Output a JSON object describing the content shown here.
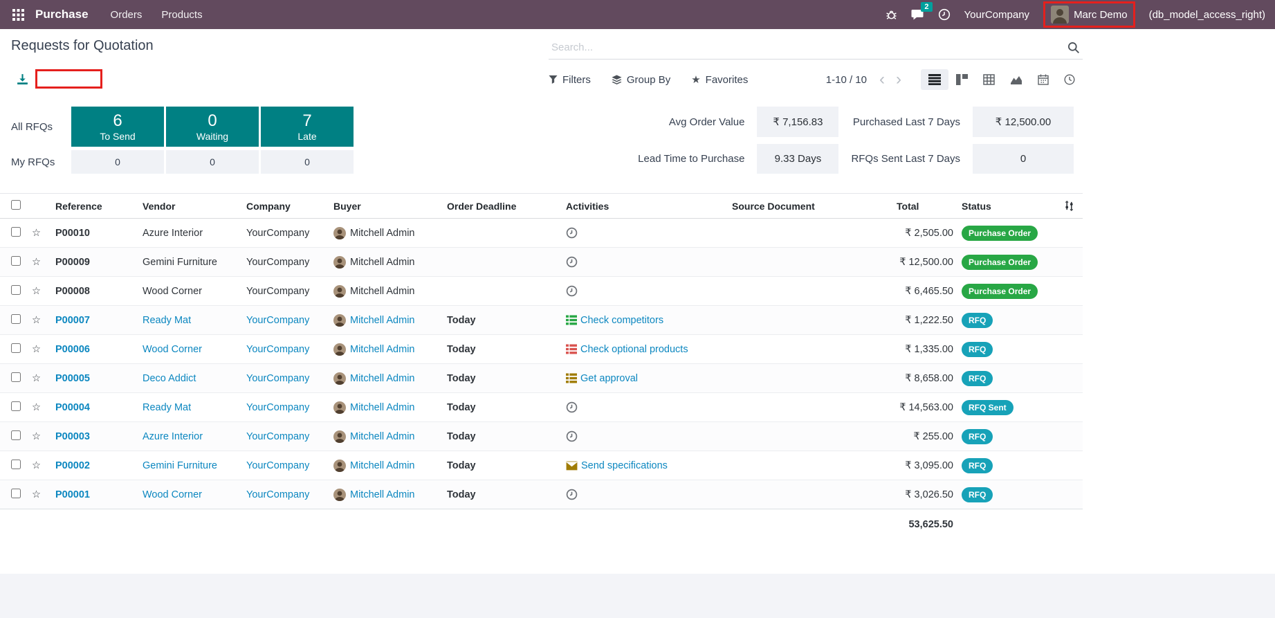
{
  "topbar": {
    "app_name": "Purchase",
    "menus": [
      {
        "label": "Orders"
      },
      {
        "label": "Products"
      }
    ],
    "message_count": "2",
    "company": "YourCompany",
    "user_name": "Marc Demo",
    "user_suffix": "(db_model_access_right)"
  },
  "page": {
    "title": "Requests for Quotation"
  },
  "search": {
    "placeholder": "Search..."
  },
  "controls": {
    "filters_label": "Filters",
    "group_by_label": "Group By",
    "favorites_label": "Favorites",
    "pager": "1-10 / 10"
  },
  "dashboard": {
    "all_label": "All RFQs",
    "my_label": "My RFQs",
    "boxes": [
      {
        "value": "6",
        "label": "To Send",
        "my_value": "0"
      },
      {
        "value": "0",
        "label": "Waiting",
        "my_value": "0"
      },
      {
        "value": "7",
        "label": "Late",
        "my_value": "0"
      }
    ],
    "stats": [
      {
        "label": "Avg Order Value",
        "value": "₹ 7,156.83"
      },
      {
        "label": "Purchased Last 7 Days",
        "value": "₹ 12,500.00"
      },
      {
        "label": "Lead Time to Purchase",
        "value": "9.33 Days"
      },
      {
        "label": "RFQs Sent Last 7 Days",
        "value": "0"
      }
    ]
  },
  "table": {
    "columns": [
      "Reference",
      "Vendor",
      "Company",
      "Buyer",
      "Order Deadline",
      "Activities",
      "Source Document",
      "Total",
      "Status"
    ],
    "rows": [
      {
        "ref": "P00010",
        "vendor": "Azure Interior",
        "company": "YourCompany",
        "buyer": "Mitchell Admin",
        "deadline": "",
        "activity": {
          "icon": "clock",
          "color": "act-gray",
          "label": ""
        },
        "total": "₹ 2,505.00",
        "status": "Purchase Order",
        "status_class": "green",
        "row_class": "plain"
      },
      {
        "ref": "P00009",
        "vendor": "Gemini Furniture",
        "company": "YourCompany",
        "buyer": "Mitchell Admin",
        "deadline": "",
        "activity": {
          "icon": "clock",
          "color": "act-gray",
          "label": ""
        },
        "total": "₹ 12,500.00",
        "status": "Purchase Order",
        "status_class": "green",
        "row_class": "plain"
      },
      {
        "ref": "P00008",
        "vendor": "Wood Corner",
        "company": "YourCompany",
        "buyer": "Mitchell Admin",
        "deadline": "",
        "activity": {
          "icon": "clock",
          "color": "act-gray",
          "label": ""
        },
        "total": "₹ 6,465.50",
        "status": "Purchase Order",
        "status_class": "green",
        "row_class": "plain"
      },
      {
        "ref": "P00007",
        "vendor": "Ready Mat",
        "company": "YourCompany",
        "buyer": "Mitchell Admin",
        "deadline": "Today",
        "activity": {
          "icon": "list",
          "color": "act-green",
          "label": "Check competitors"
        },
        "total": "₹ 1,222.50",
        "status": "RFQ",
        "status_class": "teal",
        "row_class": "linked"
      },
      {
        "ref": "P00006",
        "vendor": "Wood Corner",
        "company": "YourCompany",
        "buyer": "Mitchell Admin",
        "deadline": "Today",
        "activity": {
          "icon": "list",
          "color": "act-red",
          "label": "Check optional products"
        },
        "total": "₹ 1,335.00",
        "status": "RFQ",
        "status_class": "teal",
        "row_class": "linked"
      },
      {
        "ref": "P00005",
        "vendor": "Deco Addict",
        "company": "YourCompany",
        "buyer": "Mitchell Admin",
        "deadline": "Today",
        "activity": {
          "icon": "list",
          "color": "act-gold",
          "label": "Get approval"
        },
        "total": "₹ 8,658.00",
        "status": "RFQ",
        "status_class": "teal",
        "row_class": "linked"
      },
      {
        "ref": "P00004",
        "vendor": "Ready Mat",
        "company": "YourCompany",
        "buyer": "Mitchell Admin",
        "deadline": "Today",
        "activity": {
          "icon": "clock",
          "color": "act-gray",
          "label": ""
        },
        "total": "₹ 14,563.00",
        "status": "RFQ Sent",
        "status_class": "teal",
        "row_class": "linked"
      },
      {
        "ref": "P00003",
        "vendor": "Azure Interior",
        "company": "YourCompany",
        "buyer": "Mitchell Admin",
        "deadline": "Today",
        "activity": {
          "icon": "clock",
          "color": "act-gray",
          "label": ""
        },
        "total": "₹ 255.00",
        "status": "RFQ",
        "status_class": "teal",
        "row_class": "linked"
      },
      {
        "ref": "P00002",
        "vendor": "Gemini Furniture",
        "company": "YourCompany",
        "buyer": "Mitchell Admin",
        "deadline": "Today",
        "activity": {
          "icon": "envelope",
          "color": "act-gold",
          "label": "Send specifications"
        },
        "total": "₹ 3,095.00",
        "status": "RFQ",
        "status_class": "teal",
        "row_class": "linked"
      },
      {
        "ref": "P00001",
        "vendor": "Wood Corner",
        "company": "YourCompany",
        "buyer": "Mitchell Admin",
        "deadline": "Today",
        "activity": {
          "icon": "clock",
          "color": "act-gray",
          "label": ""
        },
        "total": "₹ 3,026.50",
        "status": "RFQ",
        "status_class": "teal",
        "row_class": "linked"
      }
    ],
    "footer_total": "53,625.50"
  },
  "colors": {
    "topbar_bg": "#624a5e",
    "kpi_teal": "#008083",
    "link_blue": "#0c87c0",
    "deadline_gold": "#b07a0b",
    "badge_green": "#28a745",
    "badge_teal": "#17a2b8",
    "annotation_red": "#e5201d"
  }
}
